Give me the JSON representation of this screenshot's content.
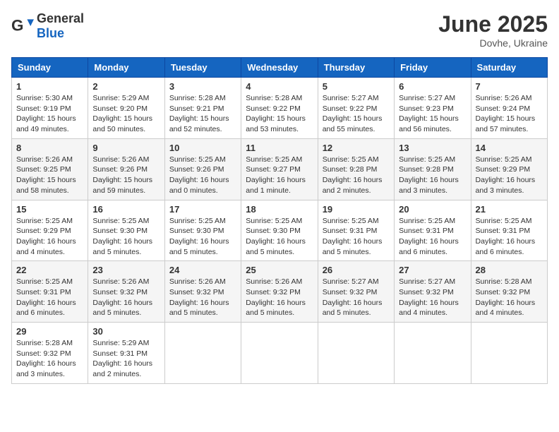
{
  "logo": {
    "general": "General",
    "blue": "Blue"
  },
  "title": "June 2025",
  "location": "Dovhe, Ukraine",
  "weekdays": [
    "Sunday",
    "Monday",
    "Tuesday",
    "Wednesday",
    "Thursday",
    "Friday",
    "Saturday"
  ],
  "weeks": [
    [
      {
        "day": "1",
        "info": "Sunrise: 5:30 AM\nSunset: 9:19 PM\nDaylight: 15 hours\nand 49 minutes."
      },
      {
        "day": "2",
        "info": "Sunrise: 5:29 AM\nSunset: 9:20 PM\nDaylight: 15 hours\nand 50 minutes."
      },
      {
        "day": "3",
        "info": "Sunrise: 5:28 AM\nSunset: 9:21 PM\nDaylight: 15 hours\nand 52 minutes."
      },
      {
        "day": "4",
        "info": "Sunrise: 5:28 AM\nSunset: 9:22 PM\nDaylight: 15 hours\nand 53 minutes."
      },
      {
        "day": "5",
        "info": "Sunrise: 5:27 AM\nSunset: 9:22 PM\nDaylight: 15 hours\nand 55 minutes."
      },
      {
        "day": "6",
        "info": "Sunrise: 5:27 AM\nSunset: 9:23 PM\nDaylight: 15 hours\nand 56 minutes."
      },
      {
        "day": "7",
        "info": "Sunrise: 5:26 AM\nSunset: 9:24 PM\nDaylight: 15 hours\nand 57 minutes."
      }
    ],
    [
      {
        "day": "8",
        "info": "Sunrise: 5:26 AM\nSunset: 9:25 PM\nDaylight: 15 hours\nand 58 minutes."
      },
      {
        "day": "9",
        "info": "Sunrise: 5:26 AM\nSunset: 9:26 PM\nDaylight: 15 hours\nand 59 minutes."
      },
      {
        "day": "10",
        "info": "Sunrise: 5:25 AM\nSunset: 9:26 PM\nDaylight: 16 hours\nand 0 minutes."
      },
      {
        "day": "11",
        "info": "Sunrise: 5:25 AM\nSunset: 9:27 PM\nDaylight: 16 hours\nand 1 minute."
      },
      {
        "day": "12",
        "info": "Sunrise: 5:25 AM\nSunset: 9:28 PM\nDaylight: 16 hours\nand 2 minutes."
      },
      {
        "day": "13",
        "info": "Sunrise: 5:25 AM\nSunset: 9:28 PM\nDaylight: 16 hours\nand 3 minutes."
      },
      {
        "day": "14",
        "info": "Sunrise: 5:25 AM\nSunset: 9:29 PM\nDaylight: 16 hours\nand 3 minutes."
      }
    ],
    [
      {
        "day": "15",
        "info": "Sunrise: 5:25 AM\nSunset: 9:29 PM\nDaylight: 16 hours\nand 4 minutes."
      },
      {
        "day": "16",
        "info": "Sunrise: 5:25 AM\nSunset: 9:30 PM\nDaylight: 16 hours\nand 5 minutes."
      },
      {
        "day": "17",
        "info": "Sunrise: 5:25 AM\nSunset: 9:30 PM\nDaylight: 16 hours\nand 5 minutes."
      },
      {
        "day": "18",
        "info": "Sunrise: 5:25 AM\nSunset: 9:30 PM\nDaylight: 16 hours\nand 5 minutes."
      },
      {
        "day": "19",
        "info": "Sunrise: 5:25 AM\nSunset: 9:31 PM\nDaylight: 16 hours\nand 5 minutes."
      },
      {
        "day": "20",
        "info": "Sunrise: 5:25 AM\nSunset: 9:31 PM\nDaylight: 16 hours\nand 6 minutes."
      },
      {
        "day": "21",
        "info": "Sunrise: 5:25 AM\nSunset: 9:31 PM\nDaylight: 16 hours\nand 6 minutes."
      }
    ],
    [
      {
        "day": "22",
        "info": "Sunrise: 5:25 AM\nSunset: 9:31 PM\nDaylight: 16 hours\nand 6 minutes."
      },
      {
        "day": "23",
        "info": "Sunrise: 5:26 AM\nSunset: 9:32 PM\nDaylight: 16 hours\nand 5 minutes."
      },
      {
        "day": "24",
        "info": "Sunrise: 5:26 AM\nSunset: 9:32 PM\nDaylight: 16 hours\nand 5 minutes."
      },
      {
        "day": "25",
        "info": "Sunrise: 5:26 AM\nSunset: 9:32 PM\nDaylight: 16 hours\nand 5 minutes."
      },
      {
        "day": "26",
        "info": "Sunrise: 5:27 AM\nSunset: 9:32 PM\nDaylight: 16 hours\nand 5 minutes."
      },
      {
        "day": "27",
        "info": "Sunrise: 5:27 AM\nSunset: 9:32 PM\nDaylight: 16 hours\nand 4 minutes."
      },
      {
        "day": "28",
        "info": "Sunrise: 5:28 AM\nSunset: 9:32 PM\nDaylight: 16 hours\nand 4 minutes."
      }
    ],
    [
      {
        "day": "29",
        "info": "Sunrise: 5:28 AM\nSunset: 9:32 PM\nDaylight: 16 hours\nand 3 minutes."
      },
      {
        "day": "30",
        "info": "Sunrise: 5:29 AM\nSunset: 9:31 PM\nDaylight: 16 hours\nand 2 minutes."
      },
      {
        "day": "",
        "info": ""
      },
      {
        "day": "",
        "info": ""
      },
      {
        "day": "",
        "info": ""
      },
      {
        "day": "",
        "info": ""
      },
      {
        "day": "",
        "info": ""
      }
    ]
  ],
  "row_shading": [
    false,
    true,
    false,
    true,
    false
  ]
}
